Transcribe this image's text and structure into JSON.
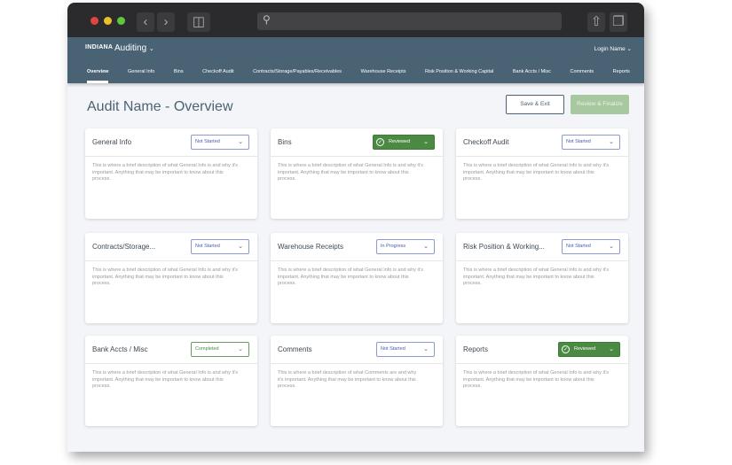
{
  "browser": {
    "back_icon": "chevron-left-icon",
    "forward_icon": "chevron-right-icon",
    "sidebar_icon": "sidebar-icon",
    "search_icon": "search-icon",
    "share_icon": "share-icon",
    "tabs_icon": "tabs-icon"
  },
  "header": {
    "logo": "INDIANA",
    "app_name": "Auditing",
    "login": "Login Name"
  },
  "nav": [
    "Overview",
    "General Info",
    "Bins",
    "Checkoff Audit",
    "Contracts/Storage/Payables/Receivables",
    "Warehouse Receipts",
    "Risk Position & Working Capital",
    "Bank Accts / Misc",
    "Comments",
    "Reports"
  ],
  "page": {
    "title": "Audit Name - Overview",
    "save_exit": "Save & Exit",
    "review_finalize": "Review & Finalize"
  },
  "colors": {
    "header": "#4a6374",
    "reviewed": "#4a8a42",
    "not_started": "#4a5ab0"
  },
  "cards": [
    {
      "title": "General Info",
      "status": "Not Started",
      "desc": "This is where a brief description of what General Info is and why it's important. Anything that may be important to know about this process."
    },
    {
      "title": "Bins",
      "status": "Reviewed",
      "desc": "This is where a brief description of what General Info is and why it's important. Anything that may be important to know about this process."
    },
    {
      "title": "Checkoff Audit",
      "status": "Not Started",
      "desc": "This is where a brief description of what General Info is and why it's important. Anything that may be important to know about this process."
    },
    {
      "title": "Contracts/Storage...",
      "status": "Not Started",
      "desc": "This is where a brief description of what General Info is and why it's important. Anything that may be important to know about this process."
    },
    {
      "title": "Warehouse Receipts",
      "status": "In Progress",
      "desc": "This is where a brief description of what General Info is and why it's important. Anything that may be important to know about this process."
    },
    {
      "title": "Risk Position & Working...",
      "status": "Not Started",
      "desc": "This is where a brief description of what General Info is and why it's important. Anything that may be important to know about this process."
    },
    {
      "title": "Bank Accts / Misc",
      "status": "Completed",
      "desc": "This is where a brief description of what General Info is and why it's important. Anything that may be important to know about this process."
    },
    {
      "title": "Comments",
      "status": "Not Started",
      "desc": "This is where a brief description of what Comments are and why it's important. Anything that may be important to know about this process."
    },
    {
      "title": "Reports",
      "status": "Reviewed",
      "desc": "This is where a brief description of what General Info is and why it's important. Anything that may be important to know about this process."
    }
  ]
}
